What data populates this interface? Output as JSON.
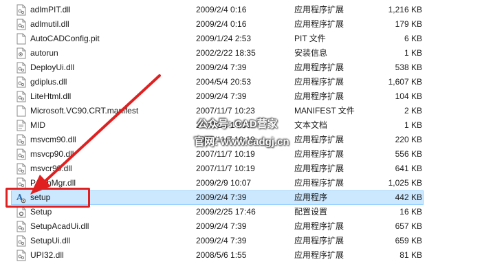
{
  "files": [
    {
      "name": "adlmPIT.dll",
      "date": "2009/2/4 0:16",
      "type": "应用程序扩展",
      "size": "1,216 KB",
      "icon": "dll-icon"
    },
    {
      "name": "adlmutil.dll",
      "date": "2009/2/4 0:16",
      "type": "应用程序扩展",
      "size": "179 KB",
      "icon": "dll-icon"
    },
    {
      "name": "AutoCADConfig.pit",
      "date": "2009/1/24 2:53",
      "type": "PIT 文件",
      "size": "6 KB",
      "icon": "file-icon"
    },
    {
      "name": "autorun",
      "date": "2002/2/22 18:35",
      "type": "安装信息",
      "size": "1 KB",
      "icon": "inf-icon"
    },
    {
      "name": "DeployUi.dll",
      "date": "2009/2/4 7:39",
      "type": "应用程序扩展",
      "size": "538 KB",
      "icon": "dll-icon"
    },
    {
      "name": "gdiplus.dll",
      "date": "2004/5/4 20:53",
      "type": "应用程序扩展",
      "size": "1,607 KB",
      "icon": "dll-icon"
    },
    {
      "name": "LiteHtml.dll",
      "date": "2009/2/4 7:39",
      "type": "应用程序扩展",
      "size": "104 KB",
      "icon": "dll-icon"
    },
    {
      "name": "Microsoft.VC90.CRT.manifest",
      "date": "2007/11/7 10:23",
      "type": "MANIFEST 文件",
      "size": "2 KB",
      "icon": "file-icon"
    },
    {
      "name": "MID",
      "date": "2009/2/4 14:30",
      "type": "文本文档",
      "size": "1 KB",
      "icon": "text-icon"
    },
    {
      "name": "msvcm90.dll",
      "date": "2007/11/7 10:19",
      "type": "应用程序扩展",
      "size": "220 KB",
      "icon": "dll-icon"
    },
    {
      "name": "msvcp90.dll",
      "date": "2007/11/7 10:19",
      "type": "应用程序扩展",
      "size": "556 KB",
      "icon": "dll-icon"
    },
    {
      "name": "msvcr90.dll",
      "date": "2007/11/7 10:19",
      "type": "应用程序扩展",
      "size": "641 KB",
      "icon": "dll-icon"
    },
    {
      "name": "PatchMgr.dll",
      "date": "2009/2/9 10:07",
      "type": "应用程序扩展",
      "size": "1,025 KB",
      "icon": "dll-icon"
    },
    {
      "name": "setup",
      "date": "2009/2/4 7:39",
      "type": "应用程序",
      "size": "442 KB",
      "icon": "setup-app-icon",
      "selected": true
    },
    {
      "name": "Setup",
      "date": "2009/2/25 17:46",
      "type": "配置设置",
      "size": "16 KB",
      "icon": "settings-file-icon"
    },
    {
      "name": "SetupAcadUi.dll",
      "date": "2009/2/4 7:39",
      "type": "应用程序扩展",
      "size": "657 KB",
      "icon": "dll-icon"
    },
    {
      "name": "SetupUi.dll",
      "date": "2009/2/4 7:39",
      "type": "应用程序扩展",
      "size": "659 KB",
      "icon": "dll-icon"
    },
    {
      "name": "UPI32.dll",
      "date": "2008/5/6 1:55",
      "type": "应用程序扩展",
      "size": "81 KB",
      "icon": "dll-icon"
    }
  ],
  "watermark": {
    "line1": "公众号: CAD营家",
    "line2": "官网: www.cadgj.cn"
  },
  "colors": {
    "selection_bg": "#cce8ff",
    "selection_border": "#99d1ff",
    "annotation_red": "#e02020"
  }
}
